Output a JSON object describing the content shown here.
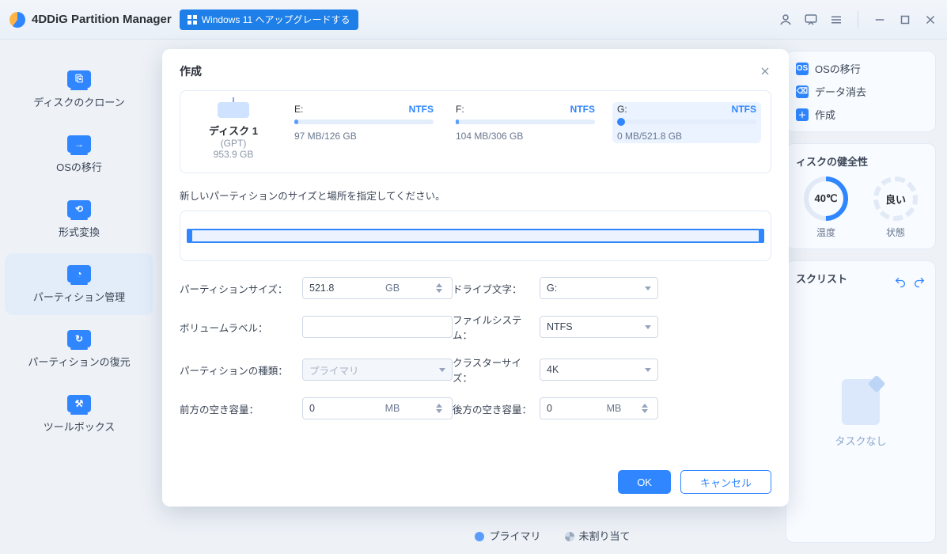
{
  "app": {
    "title": "4DDiG Partition Manager",
    "upgrade_label": "Windows 11 へアップグレードする"
  },
  "sidebar": {
    "items": [
      {
        "label": "ディスクのクローン"
      },
      {
        "label": "OSの移行"
      },
      {
        "label": "形式変換"
      },
      {
        "label": "パーティション管理"
      },
      {
        "label": "パーティションの復元"
      },
      {
        "label": "ツールボックス"
      }
    ],
    "active_index": 3
  },
  "right_panel": {
    "ops": [
      {
        "label": "OSの移行"
      },
      {
        "label": "データ消去"
      },
      {
        "label": "作成"
      }
    ],
    "health_title": "ィスクの健全性",
    "temperature_value": "40℃",
    "temperature_label": "温度",
    "status_value": "良い",
    "status_label": "状態",
    "tasks_title": "スクリスト",
    "tasks_empty": "タスクなし"
  },
  "legend": {
    "primary": "プライマリ",
    "unallocated": "未割り当て"
  },
  "modal": {
    "title": "作成",
    "disk": {
      "name": "ディスク 1",
      "type": "(GPT)",
      "size": "953.9 GB"
    },
    "partitions": [
      {
        "drive": "E:",
        "fs": "NTFS",
        "usage": "97 MB/126 GB",
        "fill_pct": 2,
        "selected": false
      },
      {
        "drive": "F:",
        "fs": "NTFS",
        "usage": "104 MB/306 GB",
        "fill_pct": 1,
        "selected": false
      },
      {
        "drive": "G:",
        "fs": "NTFS",
        "usage": "0 MB/521.8 GB",
        "fill_pct": 0,
        "selected": true
      }
    ],
    "instruction": "新しいパーティションのサイズと場所を指定してください。",
    "fields": {
      "partition_size_label": "パーティションサイズ：",
      "partition_size_value": "521.8",
      "partition_size_unit": "GB",
      "volume_label_label": "ボリュームラベル：",
      "volume_label_value": "",
      "partition_type_label": "パーティションの種類：",
      "partition_type_value": "プライマリ",
      "drive_letter_label": "ドライブ文字：",
      "drive_letter_value": "G:",
      "filesystem_label": "ファイルシステム：",
      "filesystem_value": "NTFS",
      "cluster_size_label": "クラスターサイズ：",
      "cluster_size_value": "4K",
      "unalloc_before_label": "前方の空き容量：",
      "unalloc_before_value": "0",
      "unalloc_before_unit": "MB",
      "unalloc_after_label": "後方の空き容量：",
      "unalloc_after_value": "0",
      "unalloc_after_unit": "MB"
    },
    "actions": {
      "ok": "OK",
      "cancel": "キャンセル"
    }
  }
}
